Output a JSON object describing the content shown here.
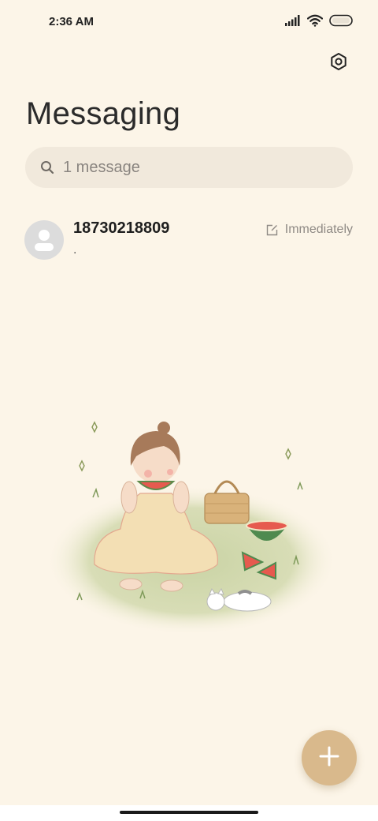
{
  "status_bar": {
    "time": "2:36 AM",
    "icons": [
      "signal-icon",
      "wifi-icon",
      "battery-icon"
    ]
  },
  "header": {
    "title": "Messaging",
    "settings_icon": "settings-hexagon-icon"
  },
  "search": {
    "placeholder": "1 message",
    "icon": "search-icon"
  },
  "conversations": [
    {
      "name": "18730218809",
      "snippet": ".",
      "time": "Immediately",
      "status_icon": "draft-icon",
      "avatar_icon": "contact-avatar-icon"
    }
  ],
  "illustration": {
    "icon": "picnic-girl-watermelon-cat-illustration"
  },
  "fab": {
    "icon": "plus-icon"
  },
  "colors": {
    "background": "#fcf5e8",
    "search_bg": "#f1e9dc",
    "fab": "#d9b98c",
    "avatar": "#dcdcdc"
  }
}
